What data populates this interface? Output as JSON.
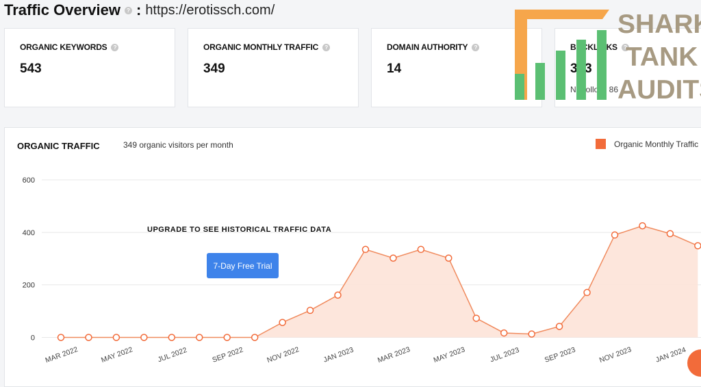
{
  "header": {
    "title": "Traffic Overview",
    "colon": ":",
    "url": "https://erotissch.com/"
  },
  "cards": [
    {
      "label": "ORGANIC KEYWORDS",
      "value": "543"
    },
    {
      "label": "ORGANIC MONTHLY TRAFFIC",
      "value": "349"
    },
    {
      "label": "DOMAIN AUTHORITY",
      "value": "14"
    },
    {
      "label": "BACKLINKS",
      "value": "323",
      "sub": "NoFollow: 86"
    }
  ],
  "panel": {
    "title": "ORGANIC TRAFFIC",
    "subtitle": "349 organic visitors per month",
    "legend": "Organic Monthly Traffic",
    "upgrade_text": "UPGRADE TO SEE HISTORICAL TRAFFIC DATA",
    "trial_button": "7-Day Free Trial"
  },
  "logo": {
    "lines": [
      "SHARK",
      "TANK",
      "AUDITS"
    ]
  },
  "colors": {
    "accent": "#f26b3a",
    "button": "#3e83ea",
    "logo_green": "#5bbf73",
    "logo_orange": "#f6a64b",
    "logo_text": "#a79a82"
  },
  "chart_data": {
    "type": "area",
    "series": [
      {
        "name": "Organic Monthly Traffic",
        "x": [
          "2022-03",
          "2022-04",
          "2022-05",
          "2022-06",
          "2022-07",
          "2022-08",
          "2022-09",
          "2022-10",
          "2022-11",
          "2022-12",
          "2023-01",
          "2023-02",
          "2023-03",
          "2023-04",
          "2023-05",
          "2023-06",
          "2023-07",
          "2023-08",
          "2023-09",
          "2023-10",
          "2023-11",
          "2023-12",
          "2024-01",
          "2024-02"
        ],
        "values": [
          0,
          0,
          0,
          0,
          0,
          0,
          0,
          0,
          57,
          103,
          161,
          335,
          302,
          335,
          302,
          73,
          17,
          13,
          42,
          171,
          390,
          425,
          395,
          349
        ]
      }
    ],
    "x_tick_labels": [
      "MAR 2022",
      "MAY 2022",
      "JUL 2022",
      "SEP 2022",
      "NOV 2022",
      "JAN 2023",
      "MAR 2023",
      "MAY 2023",
      "JUL 2023",
      "SEP 2023",
      "NOV 2023",
      "JAN 2024"
    ],
    "y_ticks": [
      0,
      200,
      400,
      600
    ],
    "ylim": [
      0,
      600
    ],
    "grid": true,
    "legend_position": "top-right"
  }
}
